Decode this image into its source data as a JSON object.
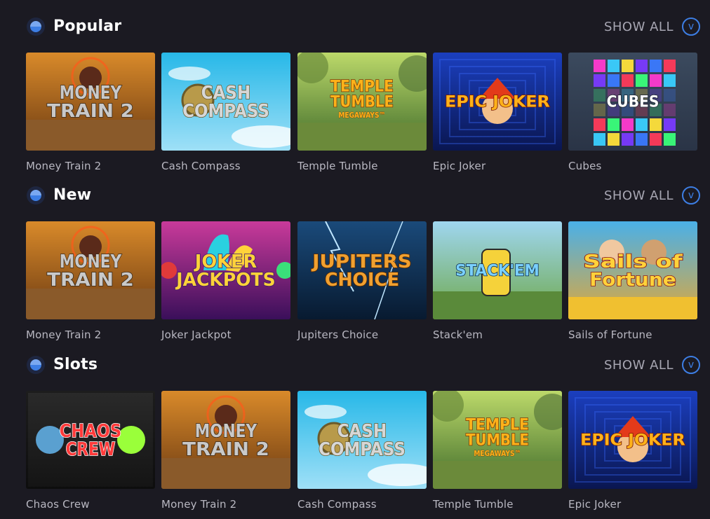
{
  "colors": {
    "background": "#1b1a22",
    "accent": "#3d7ee4",
    "muted_text": "#a7a6b2"
  },
  "sections": [
    {
      "title": "Popular",
      "icon": "category-icon",
      "show_all_label": "SHOW ALL",
      "show_all_icon": "chevron-down-icon",
      "show_all_glyph": "v",
      "games": [
        {
          "name": "Money Train 2",
          "logo_lines": [
            "MONEY",
            "TRAIN 2"
          ],
          "theme": "money-train"
        },
        {
          "name": "Cash Compass",
          "logo_lines": [
            "CASH",
            "COMPASS"
          ],
          "theme": "cash-compass"
        },
        {
          "name": "Temple Tumble",
          "logo_lines": [
            "TEMPLE",
            "TUMBLE",
            "MEGAWAYS™"
          ],
          "theme": "temple-tumble"
        },
        {
          "name": "Epic Joker",
          "logo_lines": [
            "EPIC JOKER"
          ],
          "theme": "epic-joker"
        },
        {
          "name": "Cubes",
          "logo_lines": [
            "CUBES"
          ],
          "theme": "cubes"
        }
      ]
    },
    {
      "title": "New",
      "icon": "category-icon",
      "show_all_label": "SHOW ALL",
      "show_all_icon": "chevron-down-icon",
      "show_all_glyph": "v",
      "games": [
        {
          "name": "Money Train 2",
          "logo_lines": [
            "MONEY",
            "TRAIN 2"
          ],
          "theme": "money-train"
        },
        {
          "name": "Joker Jackpot",
          "logo_lines": [
            "JOKER",
            "JACKPOTS"
          ],
          "theme": "joker-jackpot"
        },
        {
          "name": "Jupiters Choice",
          "logo_lines": [
            "JUPITERS",
            "CHOICE"
          ],
          "theme": "jupiters-choice"
        },
        {
          "name": "Stack'em",
          "logo_lines": [
            "STACK'EM"
          ],
          "theme": "stackem"
        },
        {
          "name": "Sails of Fortune",
          "logo_lines": [
            "Sails of",
            "Fortune"
          ],
          "theme": "sails-of-fortune"
        }
      ]
    },
    {
      "title": "Slots",
      "icon": "category-icon",
      "show_all_label": "SHOW ALL",
      "show_all_icon": "chevron-down-icon",
      "show_all_glyph": "v",
      "games": [
        {
          "name": "Chaos Crew",
          "logo_lines": [
            "CHAOS",
            "CREW"
          ],
          "theme": "chaos-crew"
        },
        {
          "name": "Money Train 2",
          "logo_lines": [
            "MONEY",
            "TRAIN 2"
          ],
          "theme": "money-train"
        },
        {
          "name": "Cash Compass",
          "logo_lines": [
            "CASH",
            "COMPASS"
          ],
          "theme": "cash-compass"
        },
        {
          "name": "Temple Tumble",
          "logo_lines": [
            "TEMPLE",
            "TUMBLE",
            "MEGAWAYS™"
          ],
          "theme": "temple-tumble"
        },
        {
          "name": "Epic Joker",
          "logo_lines": [
            "EPIC JOKER"
          ],
          "theme": "epic-joker"
        }
      ]
    }
  ]
}
